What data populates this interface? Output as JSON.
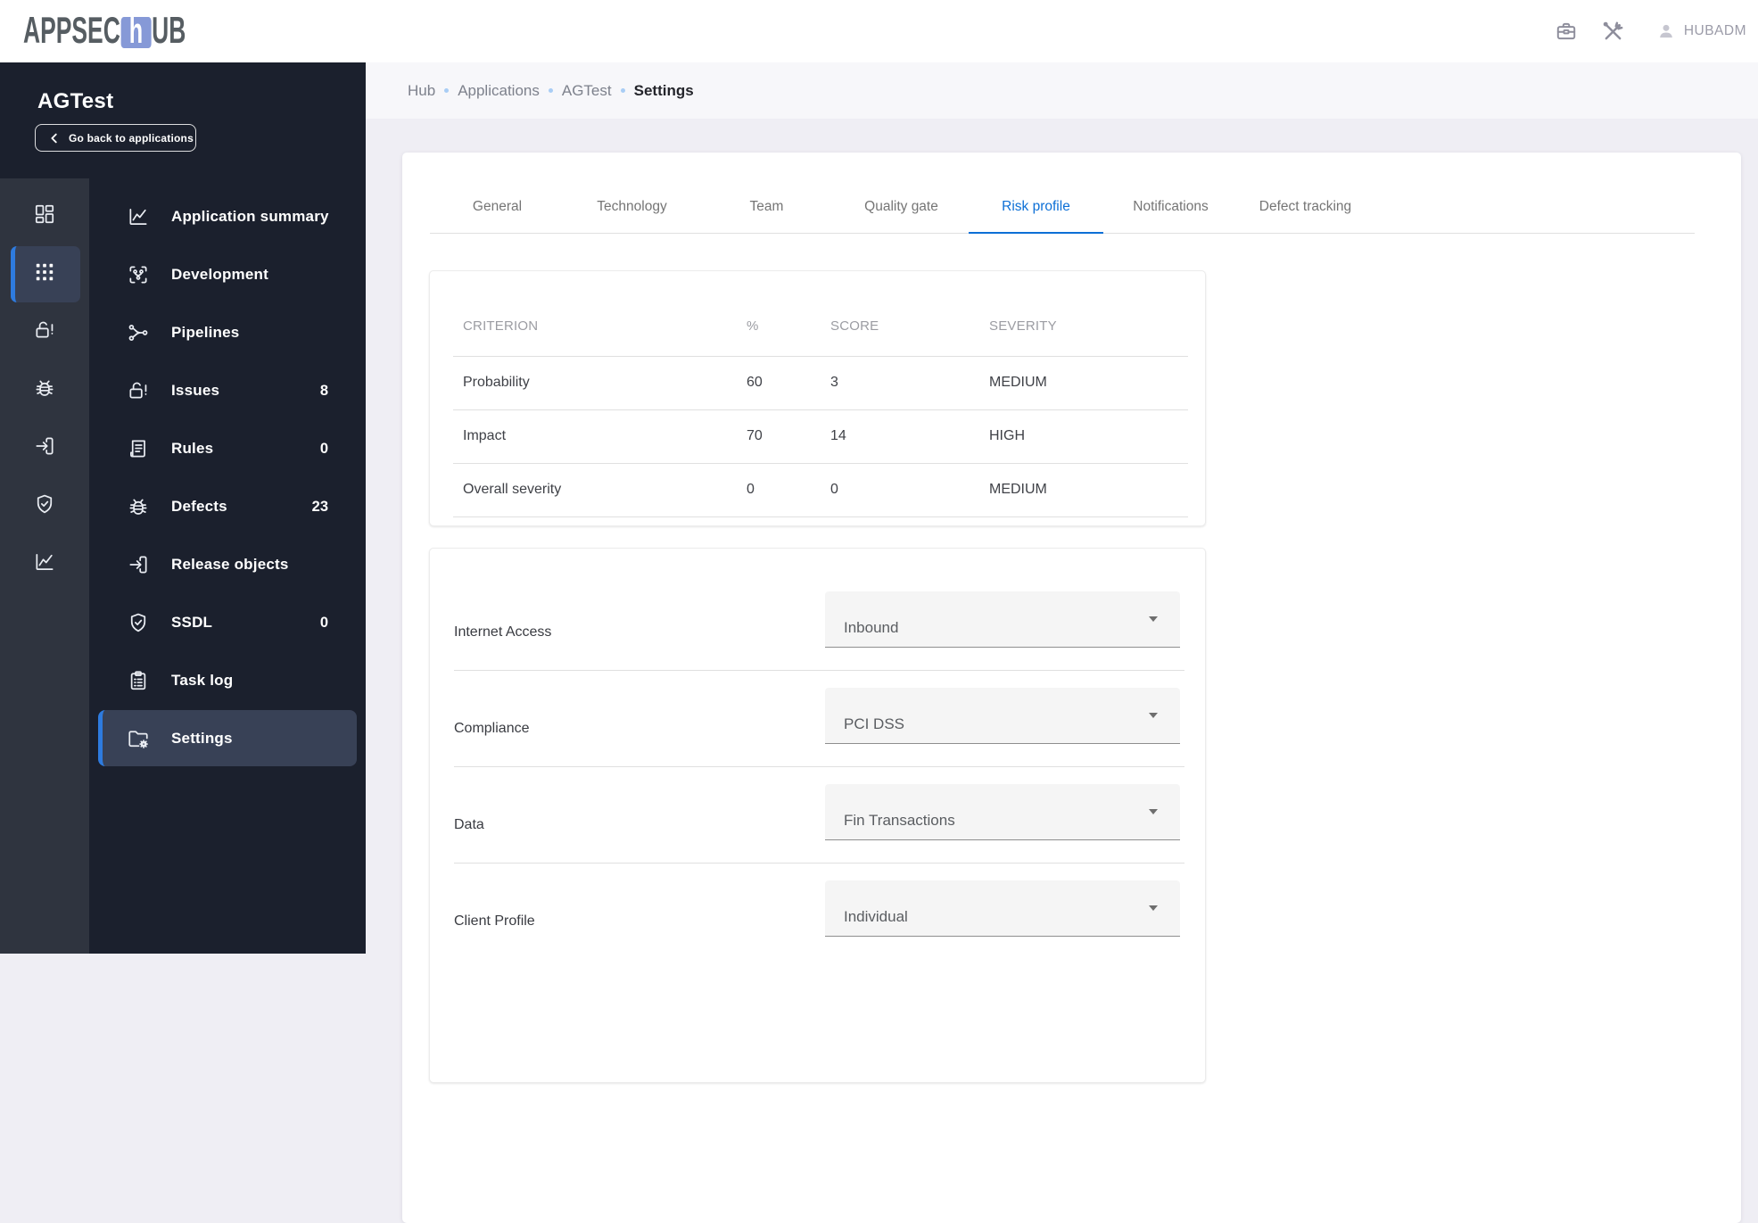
{
  "header": {
    "logo": {
      "part1": "APPSEC",
      "accent": "h",
      "part2": "UB"
    },
    "user": "HUBADM"
  },
  "sidebar": {
    "app_name": "AGTest",
    "back_button": "Go back to applications",
    "rail_items": [
      {
        "icon": "dashboard",
        "active": false
      },
      {
        "icon": "apps",
        "active": true
      },
      {
        "icon": "lock-alert",
        "active": false
      },
      {
        "icon": "bug",
        "active": false
      },
      {
        "icon": "exit",
        "active": false
      },
      {
        "icon": "shield-check",
        "active": false
      },
      {
        "icon": "chart",
        "active": false
      }
    ],
    "menu_items": [
      {
        "label": "Application summary",
        "icon": "chart",
        "badge": "",
        "active": false
      },
      {
        "label": "Development",
        "icon": "dev",
        "badge": "",
        "active": false
      },
      {
        "label": "Pipelines",
        "icon": "pipeline",
        "badge": "",
        "active": false
      },
      {
        "label": "Issues",
        "icon": "lock-alert",
        "badge": "8",
        "active": false
      },
      {
        "label": "Rules",
        "icon": "rules",
        "badge": "0",
        "active": false
      },
      {
        "label": "Defects",
        "icon": "bug",
        "badge": "23",
        "active": false
      },
      {
        "label": "Release objects",
        "icon": "exit",
        "badge": "",
        "active": false
      },
      {
        "label": "SSDL",
        "icon": "shield-check",
        "badge": "0",
        "active": false
      },
      {
        "label": "Task log",
        "icon": "task",
        "badge": "",
        "active": false
      },
      {
        "label": "Settings",
        "icon": "folder-gear",
        "badge": "",
        "active": true
      }
    ]
  },
  "breadcrumb": [
    {
      "label": "Hub",
      "current": false
    },
    {
      "label": "Applications",
      "current": false
    },
    {
      "label": "AGTest",
      "current": false
    },
    {
      "label": "Settings",
      "current": true
    }
  ],
  "tabs": [
    {
      "label": "General",
      "active": false
    },
    {
      "label": "Technology",
      "active": false
    },
    {
      "label": "Team",
      "active": false
    },
    {
      "label": "Quality gate",
      "active": false
    },
    {
      "label": "Risk profile",
      "active": true
    },
    {
      "label": "Notifications",
      "active": false
    },
    {
      "label": "Defect tracking",
      "active": false
    }
  ],
  "risk_table": {
    "columns": [
      "CRITERION",
      "%",
      "SCORE",
      "SEVERITY"
    ],
    "rows": [
      {
        "criterion": "Probability",
        "percent": "60",
        "score": "3",
        "severity": "MEDIUM"
      },
      {
        "criterion": "Impact",
        "percent": "70",
        "score": "14",
        "severity": "HIGH"
      },
      {
        "criterion": "Overall severity",
        "percent": "0",
        "score": "0",
        "severity": "MEDIUM"
      }
    ]
  },
  "form": {
    "fields": [
      {
        "label": "Internet Access",
        "value": "Inbound"
      },
      {
        "label": "Compliance",
        "value": "PCI DSS"
      },
      {
        "label": "Data",
        "value": "Fin Transactions"
      },
      {
        "label": "Client Profile",
        "value": "Individual"
      }
    ]
  }
}
